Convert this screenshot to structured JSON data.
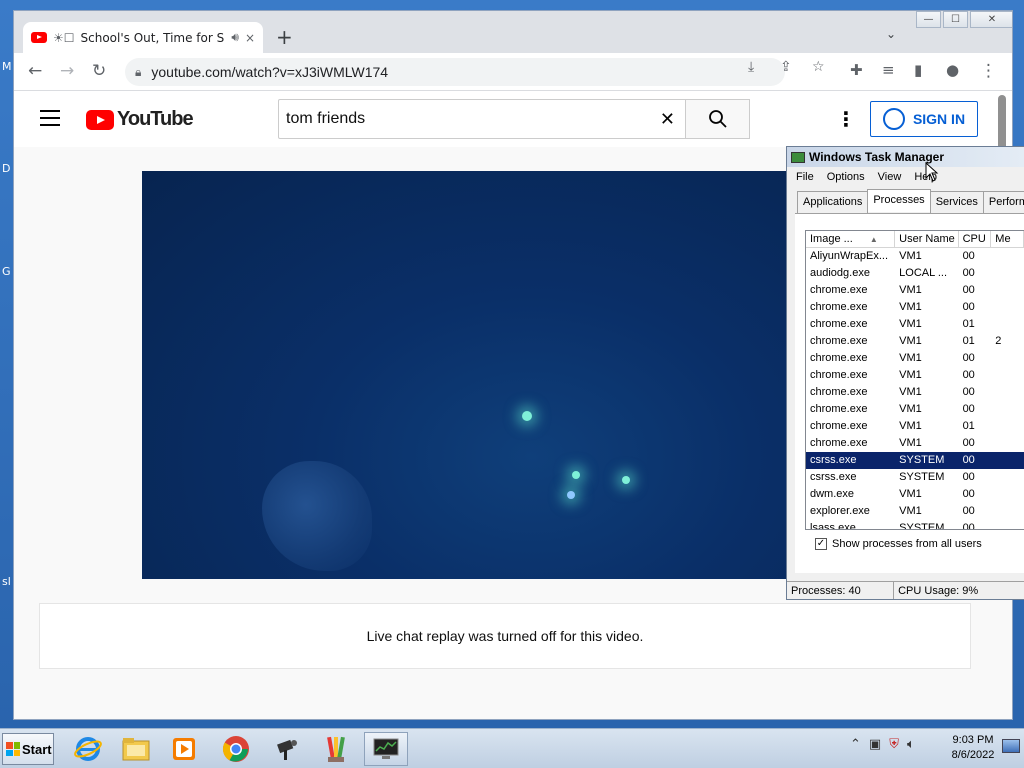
{
  "desktop": {
    "edge_letters": [
      "M",
      "D",
      "G",
      "sl"
    ]
  },
  "browser": {
    "tab": {
      "title": "School's Out, Time for Su",
      "prefix_glyph": "☀☐",
      "audio_icon": "speaker-icon",
      "close_glyph": "×"
    },
    "new_tab_glyph": "+",
    "tab_search_glyph": "⌄",
    "window_controls": {
      "minimize": "—",
      "maximize": "☐",
      "close": "✕"
    },
    "url": "youtube.com/watch?v=xJ3iWMLW174"
  },
  "youtube": {
    "logo_text": "YouTube",
    "search": {
      "value": "tom friends"
    },
    "sign_in_label": "SIGN IN",
    "live_chat_message": "Live chat replay was turned off for this video."
  },
  "task_manager": {
    "title": "Windows Task Manager",
    "menu": [
      "File",
      "Options",
      "View",
      "Help"
    ],
    "tabs": [
      "Applications",
      "Processes",
      "Services",
      "Performa"
    ],
    "active_tab": "Processes",
    "columns": [
      "Image ...",
      "User Name",
      "CPU",
      "Me"
    ],
    "rows": [
      {
        "image": "AliyunWrapEx...",
        "user": "VM1",
        "cpu": "00",
        "mem": ""
      },
      {
        "image": "audiodg.exe",
        "user": "LOCAL ...",
        "cpu": "00",
        "mem": ""
      },
      {
        "image": "chrome.exe",
        "user": "VM1",
        "cpu": "00",
        "mem": ""
      },
      {
        "image": "chrome.exe",
        "user": "VM1",
        "cpu": "00",
        "mem": ""
      },
      {
        "image": "chrome.exe",
        "user": "VM1",
        "cpu": "01",
        "mem": ""
      },
      {
        "image": "chrome.exe",
        "user": "VM1",
        "cpu": "01",
        "mem": "2"
      },
      {
        "image": "chrome.exe",
        "user": "VM1",
        "cpu": "00",
        "mem": ""
      },
      {
        "image": "chrome.exe",
        "user": "VM1",
        "cpu": "00",
        "mem": ""
      },
      {
        "image": "chrome.exe",
        "user": "VM1",
        "cpu": "00",
        "mem": ""
      },
      {
        "image": "chrome.exe",
        "user": "VM1",
        "cpu": "00",
        "mem": ""
      },
      {
        "image": "chrome.exe",
        "user": "VM1",
        "cpu": "01",
        "mem": ""
      },
      {
        "image": "chrome.exe",
        "user": "VM1",
        "cpu": "00",
        "mem": ""
      },
      {
        "image": "csrss.exe",
        "user": "SYSTEM",
        "cpu": "00",
        "mem": "",
        "selected": true
      },
      {
        "image": "csrss.exe",
        "user": "SYSTEM",
        "cpu": "00",
        "mem": ""
      },
      {
        "image": "dwm.exe",
        "user": "VM1",
        "cpu": "00",
        "mem": ""
      },
      {
        "image": "explorer.exe",
        "user": "VM1",
        "cpu": "00",
        "mem": ""
      },
      {
        "image": "lsass.exe",
        "user": "SYSTEM",
        "cpu": "00",
        "mem": ""
      }
    ],
    "show_all_users_label": "Show processes from all users",
    "show_all_users_checked": true,
    "status": {
      "processes": "Processes: 40",
      "cpu_usage": "CPU Usage: 9%"
    }
  },
  "taskbar": {
    "start_label": "Start",
    "apps": [
      "internet-explorer-icon",
      "file-explorer-icon",
      "media-player-icon",
      "chrome-icon",
      "camera-tool-icon",
      "paint-brush-icon",
      "task-manager-icon"
    ],
    "clock": {
      "time": "9:03 PM",
      "date": "8/6/2022"
    }
  }
}
